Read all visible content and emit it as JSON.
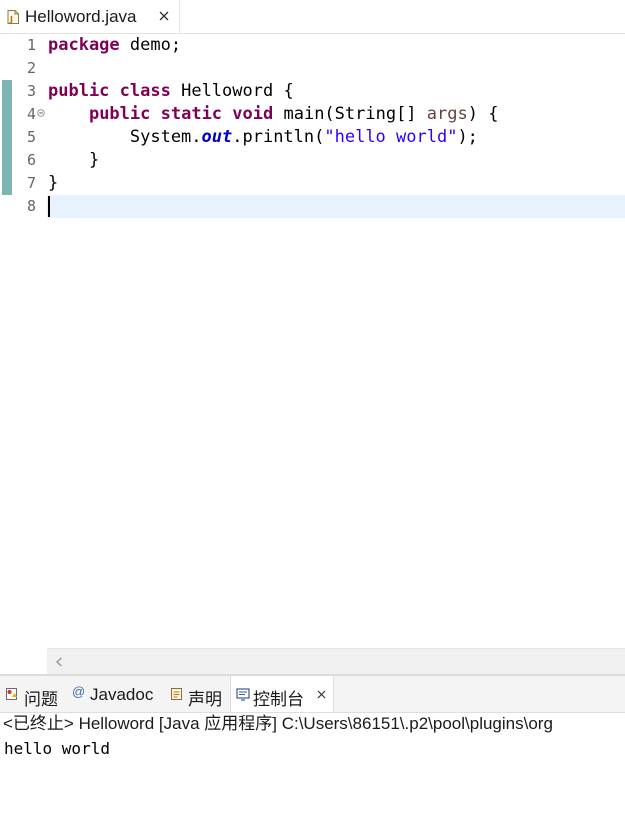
{
  "editor": {
    "tab_label": "Helloword.java",
    "line_numbers": [
      "1",
      "2",
      "3",
      "4",
      "5",
      "6",
      "7",
      "8"
    ],
    "code": {
      "l1_kw": "package",
      "l1_rest": " demo;",
      "l3_kw1": "public",
      "l3_kw2": "class",
      "l3_rest": " Helloword {",
      "l4_indent": "    ",
      "l4_kw1": "public",
      "l4_kw2": "static",
      "l4_kw3": "void",
      "l4_mid": " main(String[] ",
      "l4_param": "args",
      "l4_end": ") {",
      "l5_pre": "        System.",
      "l5_field": "out",
      "l5_mid": ".println(",
      "l5_str": "\"hello world\"",
      "l5_end": ");",
      "l6": "    }",
      "l7": "}"
    },
    "colors": {
      "keyword": "#7f0055",
      "string": "#2a00ff",
      "field": "#0000c0",
      "current_line": "#e8f2fe",
      "change_bar": "#7fb5b0"
    }
  },
  "panel": {
    "tabs": [
      {
        "label": "问题",
        "icon": "problems-icon"
      },
      {
        "label": "Javadoc",
        "icon": "javadoc-icon"
      },
      {
        "label": "声明",
        "icon": "declaration-icon"
      },
      {
        "label": "控制台",
        "icon": "console-icon"
      }
    ],
    "active_tab": "控制台",
    "console_header": "<已终止> Helloword [Java 应用程序] C:\\Users\\86151\\.p2\\pool\\plugins\\org",
    "console_output": "hello world"
  }
}
